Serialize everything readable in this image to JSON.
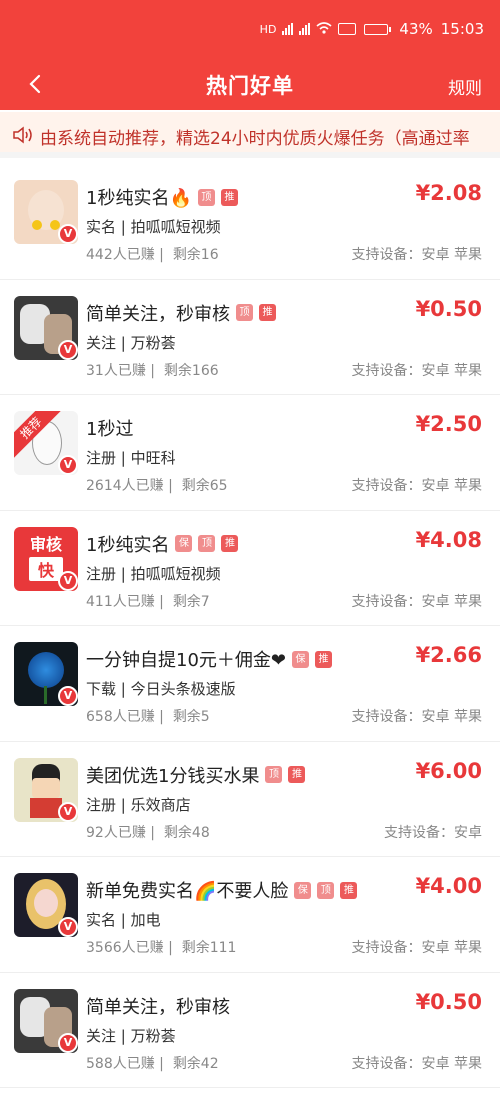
{
  "status_bar": {
    "network": "HD",
    "battery": "43%",
    "battery_level": 0.43,
    "time": "15:03"
  },
  "nav": {
    "title": "热门好单",
    "rules_label": "规则"
  },
  "notice": {
    "text": "由系统自动推荐，精选24小时内优质火爆任务（高通过率"
  },
  "colors": {
    "brand": "#f2423c",
    "price": "#e8383a"
  },
  "tasks": [
    {
      "title": "1秒纯实名🔥",
      "tags": [
        "顶",
        "推"
      ],
      "type": "实名",
      "app": "拍呱呱短视频",
      "earned": "442人已赚",
      "remain": "剩余16",
      "price": "¥2.08",
      "device": "支持设备：安卓 苹果",
      "thumb": "baby-avatar"
    },
    {
      "title": "简单关注，秒审核",
      "tags": [
        "顶",
        "推"
      ],
      "type": "关注",
      "app": "万粉荟",
      "earned": "31人已赚",
      "remain": "剩余166",
      "price": "¥0.50",
      "device": "支持设备：安卓 苹果",
      "thumb": "cat-avatar"
    },
    {
      "title": "1秒过",
      "tags": [],
      "type": "注册",
      "app": "中旺科",
      "earned": "2614人已赚",
      "remain": "剩余65",
      "price": "¥2.50",
      "device": "支持设备：安卓 苹果",
      "thumb": "sketch-girl-avatar",
      "ribbon": "推荐"
    },
    {
      "title": "1秒纯实名",
      "tags": [
        "保",
        "顶",
        "推"
      ],
      "type": "注册",
      "app": "拍呱呱短视频",
      "earned": "411人已赚",
      "remain": "剩余7",
      "price": "¥4.08",
      "device": "支持设备：安卓 苹果",
      "thumb": "audit-fast-logo",
      "logo_text": [
        "审核",
        "快"
      ]
    },
    {
      "title": "一分钟自提10元＋佣金❤",
      "tags": [
        "保",
        "推"
      ],
      "type": "下载",
      "app": "今日头条极速版",
      "earned": "658人已赚",
      "remain": "剩余5",
      "price": "¥2.66",
      "device": "支持设备：安卓 苹果",
      "thumb": "blue-rose-avatar"
    },
    {
      "title": "美团优选1分钱买水果",
      "tags": [
        "顶",
        "推"
      ],
      "type": "注册",
      "app": "乐效商店",
      "earned": "92人已赚",
      "remain": "剩余48",
      "price": "¥6.00",
      "device": "支持设备：安卓",
      "thumb": "cartoon-boy-avatar"
    },
    {
      "title": "新单免费实名🌈不要人脸",
      "tags": [
        "保",
        "顶",
        "推"
      ],
      "type": "实名",
      "app": "加电",
      "earned": "3566人已赚",
      "remain": "剩余111",
      "price": "¥4.00",
      "device": "支持设备：安卓 苹果",
      "thumb": "doll-avatar"
    },
    {
      "title": "简单关注，秒审核",
      "tags": [],
      "type": "关注",
      "app": "万粉荟",
      "earned": "588人已赚",
      "remain": "剩余42",
      "price": "¥0.50",
      "device": "支持设备：安卓 苹果",
      "thumb": "cat-avatar"
    }
  ]
}
